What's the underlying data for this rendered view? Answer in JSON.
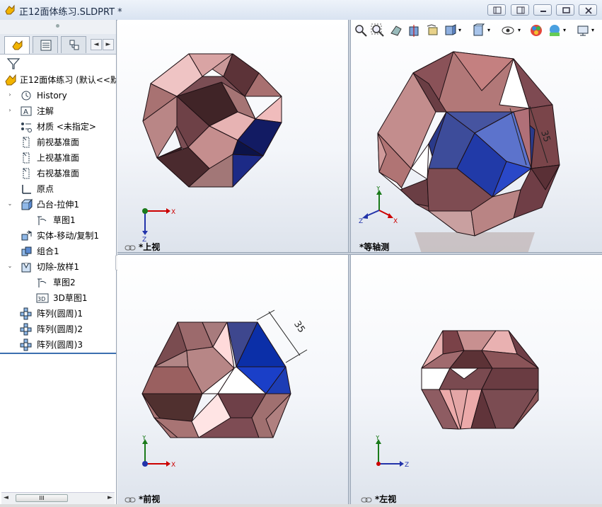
{
  "window": {
    "title": "正12面体练习.SLDPRT *"
  },
  "feature_tree": {
    "root_label": "正12面体练习  (默认<<默",
    "items": [
      {
        "label": "History",
        "icon": "history-icon"
      },
      {
        "label": "注解",
        "icon": "annotation-icon"
      },
      {
        "label": "材质 <未指定>",
        "icon": "material-icon"
      },
      {
        "label": "前视基准面",
        "icon": "plane-icon"
      },
      {
        "label": "上视基准面",
        "icon": "plane-icon"
      },
      {
        "label": "右视基准面",
        "icon": "plane-icon"
      },
      {
        "label": "原点",
        "icon": "origin-icon"
      },
      {
        "label": "凸台-拉伸1",
        "icon": "extrude-icon"
      },
      {
        "label": "草图1",
        "icon": "sketch-icon"
      },
      {
        "label": "实体-移动/复制1",
        "icon": "move-copy-icon"
      },
      {
        "label": "组合1",
        "icon": "combine-icon"
      },
      {
        "label": "切除-放样1",
        "icon": "cut-loft-icon"
      },
      {
        "label": "草图2",
        "icon": "sketch-icon"
      },
      {
        "label": "3D草图1",
        "icon": "3d-sketch-icon"
      },
      {
        "label": "阵列(圆周)1",
        "icon": "circular-pattern-icon"
      },
      {
        "label": "阵列(圆周)2",
        "icon": "circular-pattern-icon"
      },
      {
        "label": "阵列(圆周)3",
        "icon": "circular-pattern-icon"
      }
    ],
    "scroll_thumb_label": "III"
  },
  "viewports": {
    "top": {
      "label": "*上视"
    },
    "iso": {
      "label": "*等轴测",
      "dimension": "35"
    },
    "front": {
      "label": "*前视",
      "dimension": "35"
    },
    "left": {
      "label": "*左视"
    }
  },
  "axes": {
    "x": "X",
    "y": "Y",
    "z": "Z"
  },
  "colors": {
    "face_pink": "#b98080",
    "face_dark": "#5a3236",
    "face_light": "#f2c8c8",
    "face_blue": "#2a3f9e",
    "accent_blue": "#3c6fb0"
  }
}
